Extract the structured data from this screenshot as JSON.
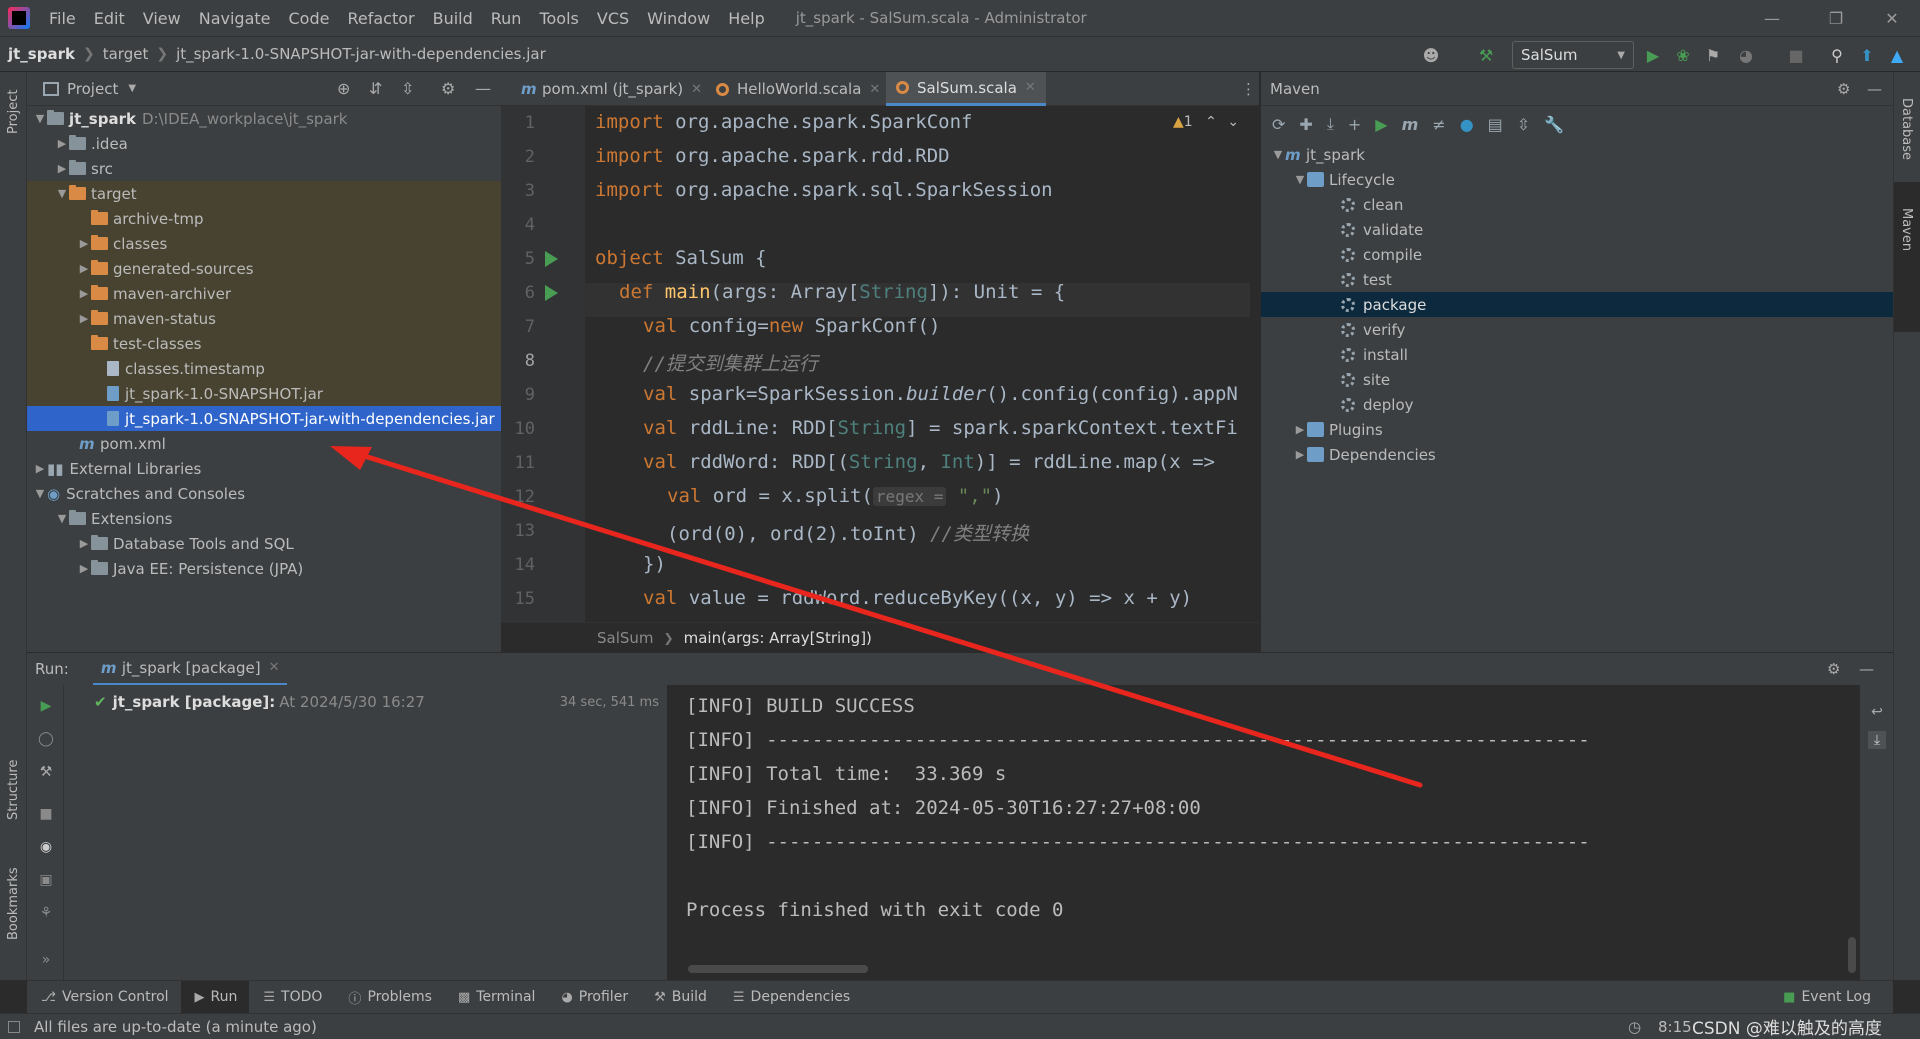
{
  "app": {
    "window_title": "jt_spark - SalSum.scala - Administrator",
    "menu": [
      "File",
      "Edit",
      "View",
      "Navigate",
      "Code",
      "Refactor",
      "Build",
      "Run",
      "Tools",
      "VCS",
      "Window",
      "Help"
    ]
  },
  "breadcrumb": [
    "jt_spark",
    "target",
    "jt_spark-1.0-SNAPSHOT-jar-with-dependencies.jar"
  ],
  "run_config": "SalSum",
  "project_panel": {
    "title": "Project",
    "root_name": "jt_spark",
    "root_path": "D:\\IDEA_workplace\\jt_spark",
    "items": [
      {
        "label": "jt_spark",
        "path": "D:\\IDEA_workplace\\jt_spark"
      },
      {
        "label": ".idea"
      },
      {
        "label": "src"
      },
      {
        "label": "target"
      },
      {
        "label": "archive-tmp"
      },
      {
        "label": "classes"
      },
      {
        "label": "generated-sources"
      },
      {
        "label": "maven-archiver"
      },
      {
        "label": "maven-status"
      },
      {
        "label": "test-classes"
      },
      {
        "label": "classes.timestamp"
      },
      {
        "label": "jt_spark-1.0-SNAPSHOT.jar"
      },
      {
        "label": "jt_spark-1.0-SNAPSHOT-jar-with-dependencies.jar"
      },
      {
        "label": "pom.xml"
      },
      {
        "label": "External Libraries"
      },
      {
        "label": "Scratches and Consoles"
      },
      {
        "label": "Extensions"
      },
      {
        "label": "Database Tools and SQL"
      },
      {
        "label": "Java EE: Persistence (JPA)"
      }
    ]
  },
  "editor_tabs": [
    {
      "label": "pom.xml (jt_spark)"
    },
    {
      "label": "HelloWorld.scala"
    },
    {
      "label": "SalSum.scala",
      "active": true
    }
  ],
  "editor": {
    "warning_count": "1",
    "line_numbers": [
      "1",
      "2",
      "3",
      "4",
      "5",
      "6",
      "7",
      "8",
      "9",
      "10",
      "11",
      "12",
      "13",
      "14",
      "15"
    ],
    "code": {
      "l1_kw": "import",
      "l1_rest": " org.apache.spark.SparkConf",
      "l2_kw": "import",
      "l2_rest": " org.apache.spark.rdd.RDD",
      "l3_kw": "import",
      "l3_rest": " org.apache.spark.sql.SparkSession",
      "l5_kw": "object",
      "l5_rest": " SalSum {",
      "l6_kw": "def ",
      "l6_fn": "main",
      "l6_a": "(args: Array[",
      "l6_ty": "String",
      "l6_b": "]): Unit = {",
      "l7_kw": "val ",
      "l7_a": "config=",
      "l7_kw2": "new ",
      "l7_b": "SparkConf()",
      "l8_cm": "//提交到集群上运行",
      "l9_kw": "val ",
      "l9_a": "spark=SparkSession.",
      "l9_it": "builder",
      "l9_b": "().config(config).appN",
      "l10_kw": "val ",
      "l10_a": "rddLine: RDD[",
      "l10_ty": "String",
      "l10_b": "] = spark.sparkContext.textFi",
      "l11_kw": "val ",
      "l11_a": "rddWord: RDD[(",
      "l11_ty": "String",
      "l11_b": ", ",
      "l11_ty2": "Int",
      "l11_c": ")] = rddLine.map(x => ",
      "l12_kw": "val ",
      "l12_a": "ord = x.split(",
      "l12_hint": "regex =",
      "l12_str": " \",\"",
      "l12_b": ")",
      "l13_a": "(ord(0), ord(2).toInt) ",
      "l13_cm": "//类型转换",
      "l14_a": "})",
      "l15_kw": "val ",
      "l15_a": "value = rddWord.reduceByKey((x, y) => x + y)"
    },
    "crumb_object": "SalSum",
    "crumb_method": "main(args: Array[String])"
  },
  "maven": {
    "title": "Maven",
    "items": [
      {
        "label": "jt_spark"
      },
      {
        "label": "Lifecycle"
      },
      {
        "label": "clean"
      },
      {
        "label": "validate"
      },
      {
        "label": "compile"
      },
      {
        "label": "test"
      },
      {
        "label": "package"
      },
      {
        "label": "verify"
      },
      {
        "label": "install"
      },
      {
        "label": "site"
      },
      {
        "label": "deploy"
      },
      {
        "label": "Plugins"
      },
      {
        "label": "Dependencies"
      }
    ]
  },
  "run_panel": {
    "label": "Run:",
    "tab": "jt_spark [package]",
    "tree_item": "jt_spark [package]:",
    "tree_time": "At 2024/5/30 16:27",
    "duration": "34 sec, 541 ms",
    "console": [
      "[INFO] BUILD SUCCESS",
      "[INFO] ------------------------------------------------------------------------",
      "[INFO] Total time:  33.369 s",
      "[INFO] Finished at: 2024-05-30T16:27:27+08:00",
      "[INFO] ------------------------------------------------------------------------",
      "",
      "Process finished with exit code 0"
    ]
  },
  "left_strip": {
    "project": "Project",
    "structure": "Structure",
    "bookmarks": "Bookmarks"
  },
  "right_strip": {
    "database": "Database",
    "maven": "Maven"
  },
  "bottom_tools": [
    "Version Control",
    "Run",
    "TODO",
    "Problems",
    "Terminal",
    "Profiler",
    "Build",
    "Dependencies"
  ],
  "event_log": "Event Log",
  "status": {
    "message": "All files are up-to-date (a minute ago)",
    "position": "8:15",
    "watermark": "CSDN @难以触及的高度"
  },
  "colors": {
    "selection": "#2f65ca",
    "accent": "#4a88c7",
    "arrow": "#e8261e",
    "run_green": "#499c54"
  }
}
